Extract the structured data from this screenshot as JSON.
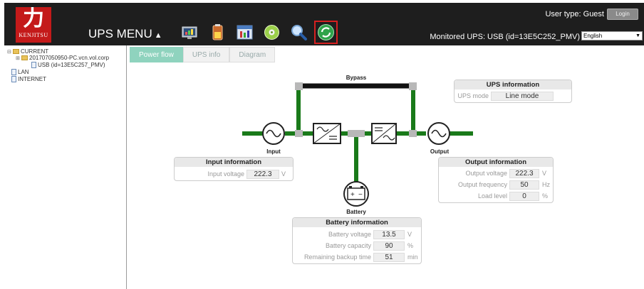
{
  "header": {
    "logo_glyph": "力",
    "logo_brand": "KENJITSU",
    "menu_title": "UPS MENU",
    "menu_arrow": "▲",
    "user_type": "User type: Guest",
    "login_label": "Login",
    "monitored": "Monitored UPS: USB (id=13E5C252_PMV)",
    "language": "English",
    "toolbar_icons": [
      "monitor-chart-icon",
      "battery-status-icon",
      "settings-tools-icon",
      "disc-icon",
      "search-icon",
      "refresh-icon"
    ]
  },
  "tree": {
    "root": "CURRENT",
    "host": "201707050950-PC.vcn.vol.corp",
    "device": "USB (id=13E5C257_PMV)",
    "lan": "LAN",
    "internet": "INTERNET"
  },
  "tabs": [
    {
      "label": "Power flow",
      "active": true
    },
    {
      "label": "UPS info",
      "active": false
    },
    {
      "label": "Diagram",
      "active": false
    }
  ],
  "flow": {
    "bypass": "Bypass",
    "input": "Input",
    "output": "Output",
    "battery": "Battery",
    "line_color": "#1a7a1a"
  },
  "ups_info": {
    "title": "UPS information",
    "mode_label": "UPS mode",
    "mode_value": "Line mode"
  },
  "input_info": {
    "title": "Input information",
    "voltage_label": "Input voltage",
    "voltage_value": "222.3",
    "voltage_unit": "V"
  },
  "output_info": {
    "title": "Output information",
    "voltage_label": "Output voltage",
    "voltage_value": "222.3",
    "voltage_unit": "V",
    "freq_label": "Output frequency",
    "freq_value": "50",
    "freq_unit": "Hz",
    "load_label": "Load level",
    "load_value": "0",
    "load_unit": "%"
  },
  "battery_info": {
    "title": "Battery information",
    "voltage_label": "Battery voltage",
    "voltage_value": "13.5",
    "voltage_unit": "V",
    "capacity_label": "Battery capacity",
    "capacity_value": "90",
    "capacity_unit": "%",
    "backup_label": "Remaining backup time",
    "backup_value": "51",
    "backup_unit": "min"
  }
}
